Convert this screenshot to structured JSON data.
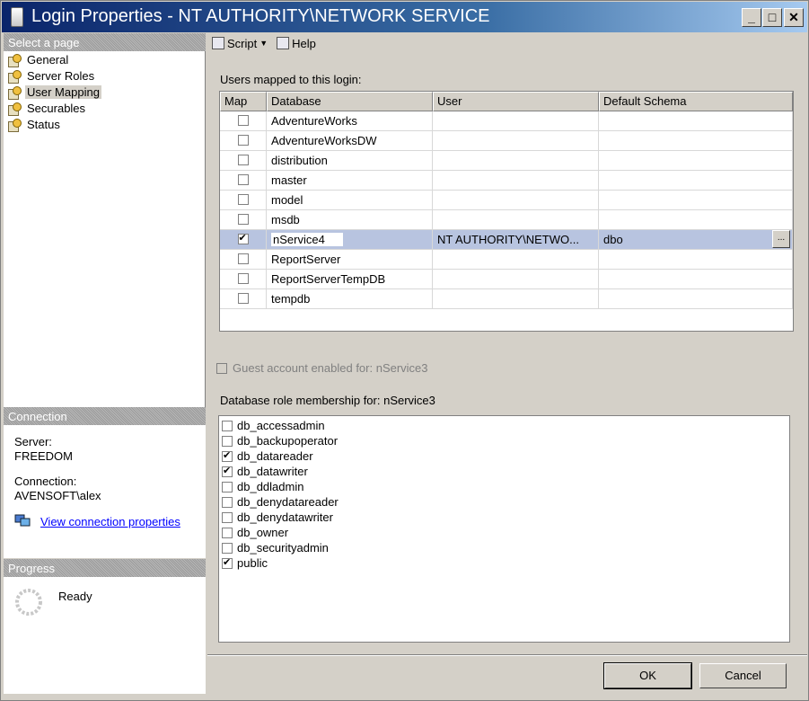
{
  "window": {
    "title": "Login Properties - NT AUTHORITY\\NETWORK SERVICE"
  },
  "titlebar_buttons": {
    "minimize": "_",
    "maximize": "□",
    "close": "✕"
  },
  "left": {
    "select_header": "Select a page",
    "pages": [
      "General",
      "Server Roles",
      "User Mapping",
      "Securables",
      "Status"
    ],
    "selected_page": "User Mapping",
    "connection_header": "Connection",
    "server_label": "Server:",
    "server_value": "FREEDOM",
    "connection_label": "Connection:",
    "connection_value": "AVENSOFT\\alex",
    "view_props_link": "View connection properties",
    "progress_header": "Progress",
    "progress_status": "Ready"
  },
  "toolbar": {
    "script_label": "Script",
    "help_label": "Help"
  },
  "mapping": {
    "label": "Users mapped to this login:",
    "columns": [
      "Map",
      "Database",
      "User",
      "Default Schema"
    ],
    "rows": [
      {
        "map": false,
        "database": "AdventureWorks",
        "user": "",
        "schema": ""
      },
      {
        "map": false,
        "database": "AdventureWorksDW",
        "user": "",
        "schema": ""
      },
      {
        "map": false,
        "database": "distribution",
        "user": "",
        "schema": ""
      },
      {
        "map": false,
        "database": "master",
        "user": "",
        "schema": ""
      },
      {
        "map": false,
        "database": "model",
        "user": "",
        "schema": ""
      },
      {
        "map": false,
        "database": "msdb",
        "user": "",
        "schema": ""
      },
      {
        "map": true,
        "database": "nService4",
        "user": "NT AUTHORITY\\NETWO...",
        "schema": "dbo",
        "selected": true
      },
      {
        "map": false,
        "database": "ReportServer",
        "user": "",
        "schema": ""
      },
      {
        "map": false,
        "database": "ReportServerTempDB",
        "user": "",
        "schema": ""
      },
      {
        "map": false,
        "database": "tempdb",
        "user": "",
        "schema": ""
      }
    ],
    "ellipsis": "..."
  },
  "guest": {
    "label": "Guest account enabled for: nService3",
    "checked": false
  },
  "roles": {
    "label": "Database role membership for: nService3",
    "items": [
      {
        "name": "db_accessadmin",
        "checked": false
      },
      {
        "name": "db_backupoperator",
        "checked": false
      },
      {
        "name": "db_datareader",
        "checked": true
      },
      {
        "name": "db_datawriter",
        "checked": true
      },
      {
        "name": "db_ddladmin",
        "checked": false
      },
      {
        "name": "db_denydatareader",
        "checked": false
      },
      {
        "name": "db_denydatawriter",
        "checked": false
      },
      {
        "name": "db_owner",
        "checked": false
      },
      {
        "name": "db_securityadmin",
        "checked": false
      },
      {
        "name": "public",
        "checked": true
      }
    ]
  },
  "buttons": {
    "ok": "OK",
    "cancel": "Cancel"
  }
}
